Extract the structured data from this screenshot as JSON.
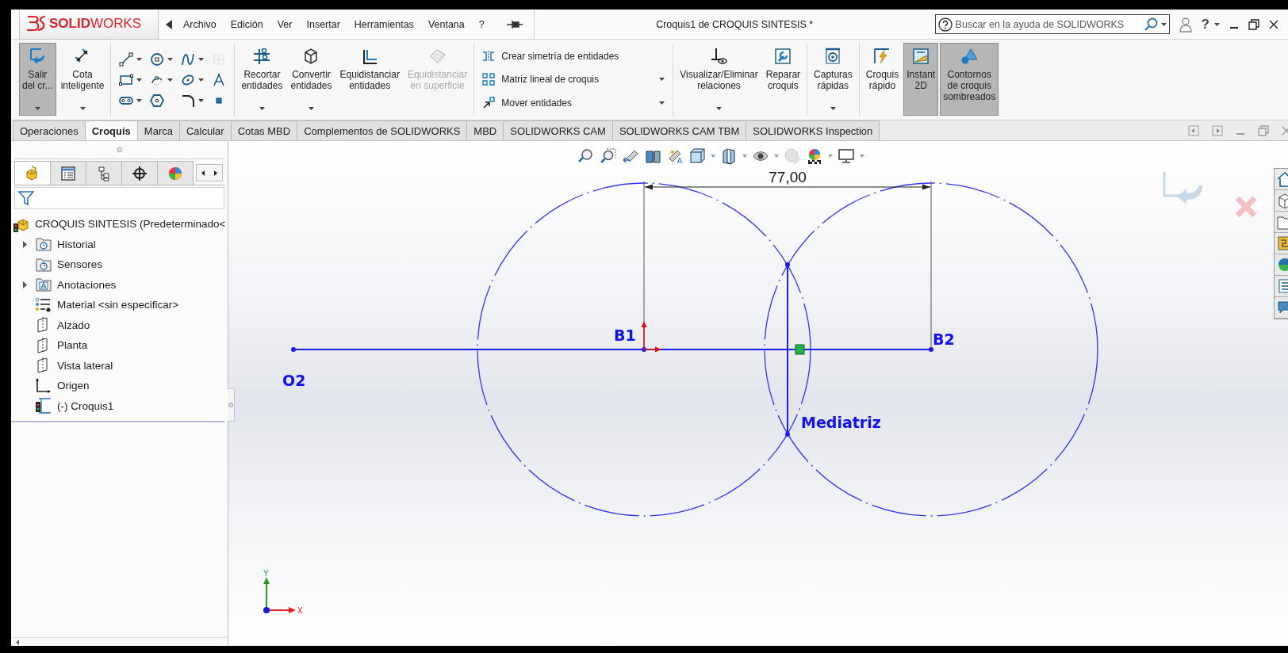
{
  "logo": "**SOLID**WORKS",
  "menu": [
    "Archivo",
    "Edición",
    "Ver",
    "Insertar",
    "Herramientas",
    "Ventana",
    "?"
  ],
  "window": {
    "title": "Croquis1 de CROQUIS SINTESIS *"
  },
  "search": {
    "placeholder": "Buscar en la ayuda de SOLIDWORKS"
  },
  "help_menu": "?",
  "ribbon": {
    "groups": [
      {
        "items": [
          {
            "kind": "large",
            "label": "Salir\ndel cr...",
            "pressed": true,
            "disabled": false,
            "dropdown": true
          },
          {
            "kind": "large",
            "label": "Cota\ninteligente",
            "pressed": false,
            "disabled": false,
            "dropdown": true
          }
        ]
      },
      {
        "items": [
          {
            "kind": "grid"
          }
        ]
      },
      {
        "items": [
          {
            "kind": "large",
            "label": "Recortar\nentidades",
            "pressed": false,
            "disabled": false,
            "dropdown": true
          },
          {
            "kind": "large",
            "label": "Convertir\nentidades",
            "pressed": false,
            "disabled": false,
            "dropdown": true
          },
          {
            "kind": "large",
            "label": "Equidistanciar\nentidades",
            "pressed": false,
            "disabled": false,
            "dropdown": false
          },
          {
            "kind": "large",
            "label": "Equidistanciar\nen superficie",
            "pressed": false,
            "disabled": true,
            "dropdown": false
          }
        ]
      },
      {
        "items": [
          {
            "kind": "rows",
            "rows": [
              {
                "label": "Crear simetría de entidades",
                "dropdown": false
              },
              {
                "label": "Matriz lineal de croquis",
                "dropdown": true
              },
              {
                "label": "Mover entidades",
                "dropdown": true
              }
            ]
          }
        ]
      },
      {
        "items": [
          {
            "kind": "large",
            "label": "Visualizar/Eliminar\nrelaciones",
            "pressed": false,
            "disabled": false,
            "dropdown": true
          },
          {
            "kind": "large",
            "label": "Reparar\ncroquis",
            "pressed": false,
            "disabled": false,
            "dropdown": false
          }
        ]
      },
      {
        "items": [
          {
            "kind": "large",
            "label": "Capturas\nrápidas",
            "pressed": false,
            "disabled": false,
            "dropdown": true
          }
        ]
      },
      {
        "items": [
          {
            "kind": "large",
            "label": "Croquis\nrápido",
            "pressed": false,
            "disabled": false,
            "dropdown": false
          },
          {
            "kind": "large",
            "label": "Instant\n2D",
            "pressed": true,
            "disabled": false,
            "dropdown": false
          },
          {
            "kind": "large",
            "label": "Contornos\nde croquis\nsombreados",
            "pressed": true,
            "disabled": false,
            "dropdown": false
          }
        ]
      }
    ]
  },
  "tabs": [
    {
      "label": "Operaciones",
      "selected": false
    },
    {
      "label": "Croquis",
      "selected": true
    },
    {
      "label": "Marca",
      "selected": false
    },
    {
      "label": "Calcular",
      "selected": false
    },
    {
      "label": "Cotas MBD",
      "selected": false
    },
    {
      "label": "Complementos de SOLIDWORKS",
      "selected": false
    },
    {
      "label": "MBD",
      "selected": false
    },
    {
      "label": "SOLIDWORKS CAM",
      "selected": false
    },
    {
      "label": "SOLIDWORKS CAM TBM",
      "selected": false
    },
    {
      "label": "SOLIDWORKS Inspection",
      "selected": false
    }
  ],
  "feature_manager": {
    "tabs": [
      {
        "selected": true
      },
      {
        "selected": false
      },
      {
        "selected": false
      },
      {
        "selected": false
      },
      {
        "selected": false
      }
    ],
    "tree": {
      "root": "CROQUIS SINTESIS  (Predeterminado<",
      "items": [
        {
          "kind": "history",
          "label": "Historial",
          "expandable": true
        },
        {
          "kind": "sensors",
          "label": "Sensores",
          "expandable": false
        },
        {
          "kind": "annotations",
          "label": "Anotaciones",
          "expandable": true
        },
        {
          "kind": "material",
          "label": "Material <sin especificar>",
          "expandable": false
        },
        {
          "kind": "plane",
          "label": "Alzado",
          "expandable": false
        },
        {
          "kind": "plane",
          "label": "Planta",
          "expandable": false
        },
        {
          "kind": "plane",
          "label": "Vista lateral",
          "expandable": false
        },
        {
          "kind": "origin",
          "label": "Origen",
          "expandable": false
        },
        {
          "kind": "sketch",
          "label": "(-) Croquis1",
          "expandable": false
        }
      ]
    }
  },
  "canvas": {
    "dimension": "77,00",
    "point_labels": [
      "B1",
      "B2",
      "O2",
      "Mediatriz"
    ],
    "axes": {
      "y": "Y",
      "x": "X"
    }
  }
}
